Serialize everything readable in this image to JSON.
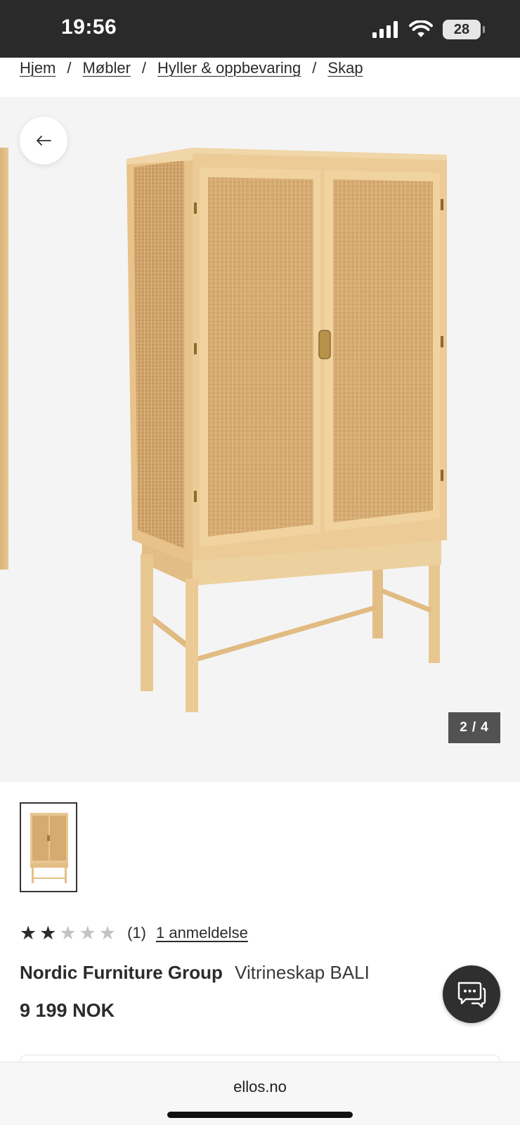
{
  "status_bar": {
    "time": "19:56",
    "battery": "28",
    "icons": [
      "signal-icon",
      "wifi-icon",
      "battery-icon"
    ]
  },
  "breadcrumb": {
    "items": [
      "Hjem",
      "Møbler",
      "Hyller & oppbevaring",
      "Skap"
    ],
    "separator": "/"
  },
  "gallery": {
    "back_icon": "arrow-left-icon",
    "current": "2",
    "separator": "/",
    "total": "4"
  },
  "product": {
    "rating": {
      "value": 2,
      "max": 5,
      "count": "(1)",
      "reviews_link": "1 anmeldelse"
    },
    "brand": "Nordic Furniture Group",
    "name": "Vitrineskap BALI",
    "price": "9 199 NOK"
  },
  "chat": {
    "icon": "chat-icon"
  },
  "browser": {
    "url": "ellos.no"
  },
  "colors": {
    "status_bar": "#2a2a2a",
    "gallery_bg": "#f4f4f4",
    "counter_bg": "#525252",
    "chat_bg": "#2f2f2f",
    "wood": "#e8c690",
    "rattan": "#d9b07a"
  }
}
